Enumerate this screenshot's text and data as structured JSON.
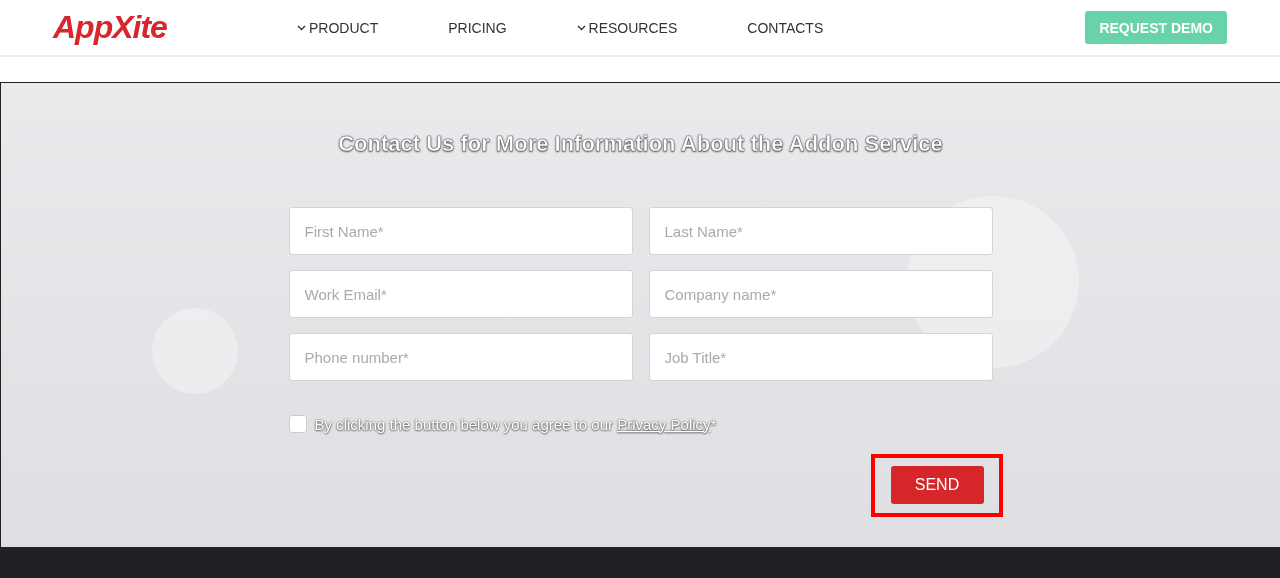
{
  "header": {
    "logo": "AppXite",
    "nav": [
      {
        "label": "PRODUCT",
        "has_dropdown": true
      },
      {
        "label": "PRICING",
        "has_dropdown": false
      },
      {
        "label": "RESOURCES",
        "has_dropdown": true
      },
      {
        "label": "CONTACTS",
        "has_dropdown": false
      }
    ],
    "cta": "REQUEST DEMO"
  },
  "form": {
    "title": "Contact Us for More Information About the Addon Service",
    "fields": [
      {
        "placeholder": "First Name*"
      },
      {
        "placeholder": "Last Name*"
      },
      {
        "placeholder": "Work Email*"
      },
      {
        "placeholder": "Company name*"
      },
      {
        "placeholder": "Phone number*"
      },
      {
        "placeholder": "Job Title*"
      }
    ],
    "consent": {
      "checked": false,
      "text": "By clicking the button below you agree to our",
      "link": "Privacy Policy",
      "suffix": "*"
    },
    "send_button": {
      "label": "SEND",
      "highlighted": true
    }
  }
}
